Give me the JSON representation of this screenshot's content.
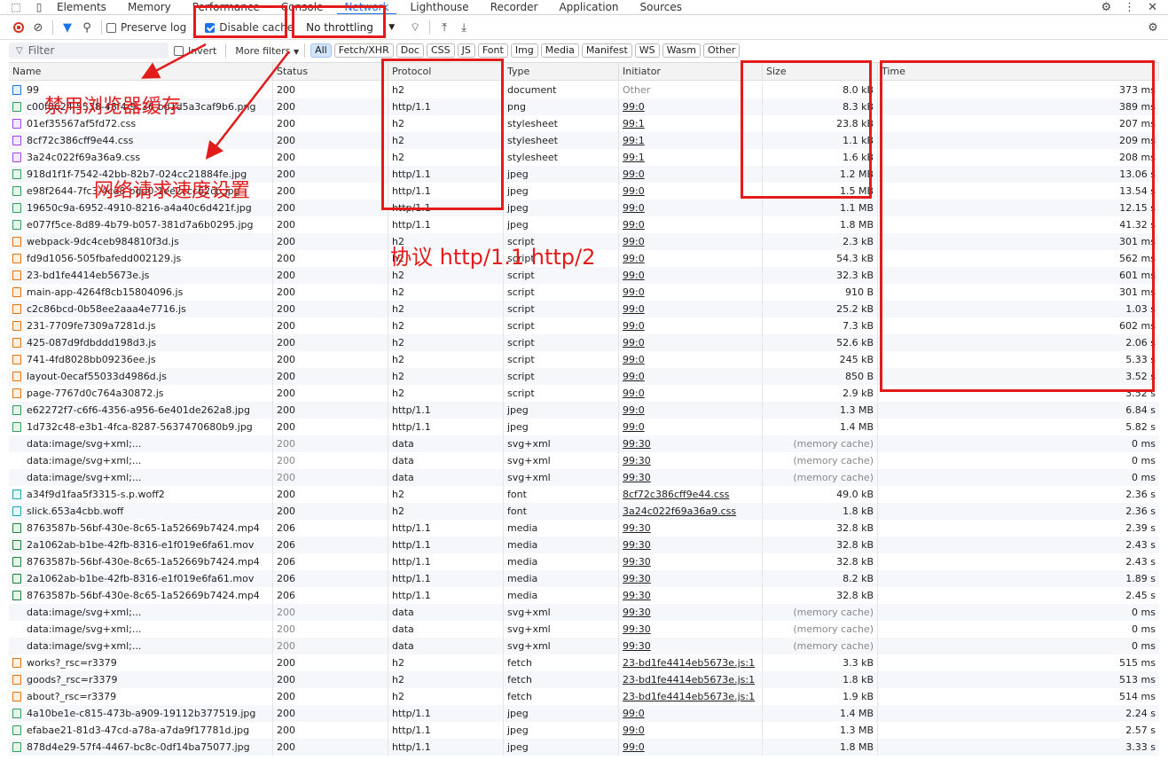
{
  "tabs": [
    "Elements",
    "Memory",
    "Performance",
    "Console",
    "Network",
    "Lighthouse",
    "Recorder",
    "Application",
    "Sources"
  ],
  "active_tab": "Network",
  "toolbar": {
    "preserve_log": "Preserve log",
    "disable_cache": "Disable cache",
    "throttling": "No throttling"
  },
  "filter": {
    "placeholder": "Filter",
    "invert": "Invert",
    "more_filters": "More filters",
    "types": [
      "All",
      "Fetch/XHR",
      "Doc",
      "CSS",
      "JS",
      "Font",
      "Img",
      "Media",
      "Manifest",
      "WS",
      "Wasm",
      "Other"
    ]
  },
  "columns": [
    "Name",
    "Status",
    "Protocol",
    "Type",
    "Initiator",
    "Size",
    "Time"
  ],
  "rows": [
    {
      "name": "99",
      "icon": "doc",
      "status": "200",
      "protocol": "h2",
      "type": "document",
      "initiator": "Other",
      "size": "8.0 kB",
      "time": "373 ms"
    },
    {
      "name": "c00f8624-5538-48f4-9c36-bd1d5a3caf9b6.png",
      "icon": "img",
      "status": "200",
      "protocol": "http/1.1",
      "type": "png",
      "initiator": "99:0",
      "size": "8.3 kB",
      "time": "389 ms"
    },
    {
      "name": "01ef35567af5fd72.css",
      "icon": "css",
      "status": "200",
      "protocol": "h2",
      "type": "stylesheet",
      "initiator": "99:1",
      "size": "23.8 kB",
      "time": "207 ms"
    },
    {
      "name": "8cf72c386cff9e44.css",
      "icon": "css",
      "status": "200",
      "protocol": "h2",
      "type": "stylesheet",
      "initiator": "99:1",
      "size": "1.1 kB",
      "time": "209 ms"
    },
    {
      "name": "3a24c022f69a36a9.css",
      "icon": "css",
      "status": "200",
      "protocol": "h2",
      "type": "stylesheet",
      "initiator": "99:1",
      "size": "1.6 kB",
      "time": "208 ms"
    },
    {
      "name": "918d1f1f-7542-42bb-82b7-024cc21884fe.jpg",
      "icon": "img",
      "status": "200",
      "protocol": "http/1.1",
      "type": "jpeg",
      "initiator": "99:0",
      "size": "1.2 MB",
      "time": "13.06 s"
    },
    {
      "name": "e98f2644-7fc3-4cd8-bdd0-1ee2ccc62cb.jpg",
      "icon": "img",
      "status": "200",
      "protocol": "http/1.1",
      "type": "jpeg",
      "initiator": "99:0",
      "size": "1.5 MB",
      "time": "13.54 s"
    },
    {
      "name": "19650c9a-6952-4910-8216-a4a40c6d421f.jpg",
      "icon": "img",
      "status": "200",
      "protocol": "http/1.1",
      "type": "jpeg",
      "initiator": "99:0",
      "size": "1.1 MB",
      "time": "12.15 s"
    },
    {
      "name": "e077f5ce-8d89-4b79-b057-381d7a6b0295.jpg",
      "icon": "img",
      "status": "200",
      "protocol": "http/1.1",
      "type": "jpeg",
      "initiator": "99:0",
      "size": "1.8 MB",
      "time": "41.32 s"
    },
    {
      "name": "webpack-9dc4ceb984810f3d.js",
      "icon": "js",
      "status": "200",
      "protocol": "h2",
      "type": "script",
      "initiator": "99:0",
      "size": "2.3 kB",
      "time": "301 ms"
    },
    {
      "name": "fd9d1056-505fbafedd002129.js",
      "icon": "js",
      "status": "200",
      "protocol": "h2",
      "type": "script",
      "initiator": "99:0",
      "size": "54.3 kB",
      "time": "562 ms"
    },
    {
      "name": "23-bd1fe4414eb5673e.js",
      "icon": "js",
      "status": "200",
      "protocol": "h2",
      "type": "script",
      "initiator": "99:0",
      "size": "32.3 kB",
      "time": "601 ms"
    },
    {
      "name": "main-app-4264f8cb15804096.js",
      "icon": "js",
      "status": "200",
      "protocol": "h2",
      "type": "script",
      "initiator": "99:0",
      "size": "910 B",
      "time": "301 ms"
    },
    {
      "name": "c2c86bcd-0b58ee2aaa4e7716.js",
      "icon": "js",
      "status": "200",
      "protocol": "h2",
      "type": "script",
      "initiator": "99:0",
      "size": "25.2 kB",
      "time": "1.03 s"
    },
    {
      "name": "231-7709fe7309a7281d.js",
      "icon": "js",
      "status": "200",
      "protocol": "h2",
      "type": "script",
      "initiator": "99:0",
      "size": "7.3 kB",
      "time": "602 ms"
    },
    {
      "name": "425-087d9fdbddd198d3.js",
      "icon": "js",
      "status": "200",
      "protocol": "h2",
      "type": "script",
      "initiator": "99:0",
      "size": "52.6 kB",
      "time": "2.06 s"
    },
    {
      "name": "741-4fd8028bb09236ee.js",
      "icon": "js",
      "status": "200",
      "protocol": "h2",
      "type": "script",
      "initiator": "99:0",
      "size": "245 kB",
      "time": "5.33 s"
    },
    {
      "name": "layout-0ecaf55033d4986d.js",
      "icon": "js",
      "status": "200",
      "protocol": "h2",
      "type": "script",
      "initiator": "99:0",
      "size": "850 B",
      "time": "3.52 s"
    },
    {
      "name": "page-7767d0c764a30872.js",
      "icon": "js",
      "status": "200",
      "protocol": "h2",
      "type": "script",
      "initiator": "99:0",
      "size": "2.9 kB",
      "time": "3.52 s"
    },
    {
      "name": "e62272f7-c6f6-4356-a956-6e401de262a8.jpg",
      "icon": "img",
      "status": "200",
      "protocol": "http/1.1",
      "type": "jpeg",
      "initiator": "99:0",
      "size": "1.3 MB",
      "time": "6.84 s"
    },
    {
      "name": "1d732c48-e3b1-4fca-8287-5637470680b9.jpg",
      "icon": "img",
      "status": "200",
      "protocol": "http/1.1",
      "type": "jpeg",
      "initiator": "99:0",
      "size": "1.4 MB",
      "time": "5.82 s"
    },
    {
      "name": "data:image/svg+xml;...",
      "icon": "svg",
      "status": "200",
      "status_dim": true,
      "protocol": "data",
      "type": "svg+xml",
      "initiator": "99:30",
      "size": "(memory cache)",
      "size_dim": true,
      "time": "0 ms"
    },
    {
      "name": "data:image/svg+xml;...",
      "icon": "svg",
      "status": "200",
      "status_dim": true,
      "protocol": "data",
      "type": "svg+xml",
      "initiator": "99:30",
      "size": "(memory cache)",
      "size_dim": true,
      "time": "0 ms"
    },
    {
      "name": "data:image/svg+xml;...",
      "icon": "svg",
      "status": "200",
      "status_dim": true,
      "protocol": "data",
      "type": "svg+xml",
      "initiator": "99:30",
      "size": "(memory cache)",
      "size_dim": true,
      "time": "0 ms"
    },
    {
      "name": "a34f9d1faa5f3315-s.p.woff2",
      "icon": "font",
      "status": "200",
      "protocol": "h2",
      "type": "font",
      "initiator": "8cf72c386cff9e44.css",
      "size": "49.0 kB",
      "time": "2.36 s"
    },
    {
      "name": "slick.653a4cbb.woff",
      "icon": "font",
      "status": "200",
      "protocol": "h2",
      "type": "font",
      "initiator": "3a24c022f69a36a9.css",
      "size": "1.8 kB",
      "time": "2.36 s"
    },
    {
      "name": "8763587b-56bf-430e-8c65-1a52669b7424.mp4",
      "icon": "media",
      "status": "206",
      "protocol": "http/1.1",
      "type": "media",
      "initiator": "99:30",
      "size": "32.8 kB",
      "time": "2.39 s"
    },
    {
      "name": "2a1062ab-b1be-42fb-8316-e1f019e6fa61.mov",
      "icon": "media",
      "status": "206",
      "protocol": "http/1.1",
      "type": "media",
      "initiator": "99:30",
      "size": "32.8 kB",
      "time": "2.43 s"
    },
    {
      "name": "8763587b-56bf-430e-8c65-1a52669b7424.mp4",
      "icon": "media",
      "status": "206",
      "protocol": "http/1.1",
      "type": "media",
      "initiator": "99:30",
      "size": "32.8 kB",
      "time": "2.43 s"
    },
    {
      "name": "2a1062ab-b1be-42fb-8316-e1f019e6fa61.mov",
      "icon": "media",
      "status": "206",
      "protocol": "http/1.1",
      "type": "media",
      "initiator": "99:30",
      "size": "8.2 kB",
      "time": "1.89 s"
    },
    {
      "name": "8763587b-56bf-430e-8c65-1a52669b7424.mp4",
      "icon": "media",
      "status": "206",
      "protocol": "http/1.1",
      "type": "media",
      "initiator": "99:30",
      "size": "32.8 kB",
      "time": "2.45 s"
    },
    {
      "name": "data:image/svg+xml;...",
      "icon": "svg",
      "status": "200",
      "status_dim": true,
      "protocol": "data",
      "type": "svg+xml",
      "initiator": "99:30",
      "size": "(memory cache)",
      "size_dim": true,
      "time": "0 ms"
    },
    {
      "name": "data:image/svg+xml;...",
      "icon": "svg",
      "status": "200",
      "status_dim": true,
      "protocol": "data",
      "type": "svg+xml",
      "initiator": "99:30",
      "size": "(memory cache)",
      "size_dim": true,
      "time": "0 ms"
    },
    {
      "name": "data:image/svg+xml;...",
      "icon": "svg",
      "status": "200",
      "status_dim": true,
      "protocol": "data",
      "type": "svg+xml",
      "initiator": "99:30",
      "size": "(memory cache)",
      "size_dim": true,
      "time": "0 ms"
    },
    {
      "name": "works?_rsc=r3379",
      "icon": "fetch",
      "status": "200",
      "protocol": "h2",
      "type": "fetch",
      "initiator": "23-bd1fe4414eb5673e.js:1",
      "size": "3.3 kB",
      "time": "515 ms"
    },
    {
      "name": "goods?_rsc=r3379",
      "icon": "fetch",
      "status": "200",
      "protocol": "h2",
      "type": "fetch",
      "initiator": "23-bd1fe4414eb5673e.js:1",
      "size": "1.8 kB",
      "time": "513 ms"
    },
    {
      "name": "about?_rsc=r3379",
      "icon": "fetch",
      "status": "200",
      "protocol": "h2",
      "type": "fetch",
      "initiator": "23-bd1fe4414eb5673e.js:1",
      "size": "1.9 kB",
      "time": "514 ms"
    },
    {
      "name": "4a10be1e-c815-473b-a909-19112b377519.jpg",
      "icon": "img",
      "status": "200",
      "protocol": "http/1.1",
      "type": "jpeg",
      "initiator": "99:0",
      "size": "1.4 MB",
      "time": "2.24 s"
    },
    {
      "name": "efabae21-81d3-47cd-a78a-a7da9f17781d.jpg",
      "icon": "img",
      "status": "200",
      "protocol": "http/1.1",
      "type": "jpeg",
      "initiator": "99:0",
      "size": "1.3 MB",
      "time": "2.57 s"
    },
    {
      "name": "878d4e29-57f4-4467-bc8c-0df14ba75077.jpg",
      "icon": "img",
      "status": "200",
      "protocol": "http/1.1",
      "type": "jpeg",
      "initiator": "99:0",
      "size": "1.8 MB",
      "time": "3.33 s"
    }
  ],
  "annotations": {
    "disable_cache_note": "禁用浏览器缓存",
    "throttle_note": "网络请求速度设置",
    "protocol_note": "协议 http/1.1 http/2"
  },
  "colors": {
    "annotation": "#e31b1b",
    "accent": "#1a73e8"
  }
}
